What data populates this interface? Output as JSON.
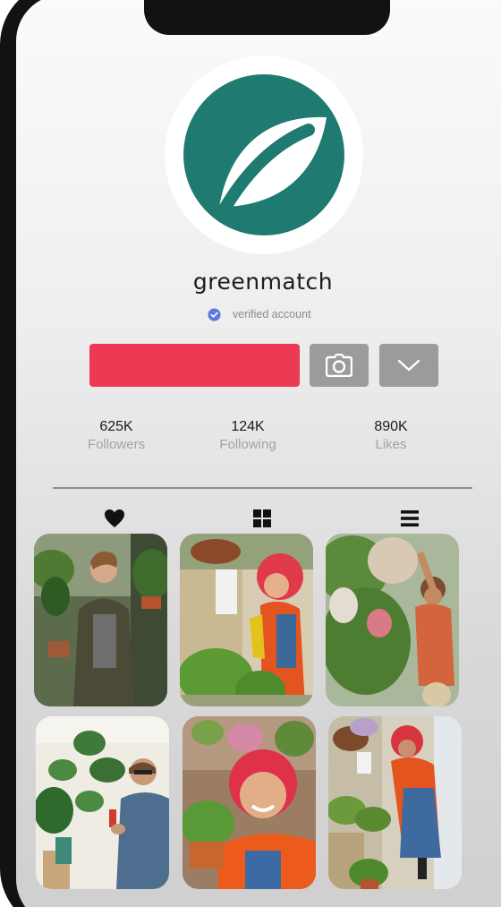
{
  "profile": {
    "username": "greenmatch",
    "verified_label": "verified account",
    "logo_icon": "leaf-logo-icon",
    "colors": {
      "logo": "#1f7a72",
      "follow_button": "#ec3a55",
      "secondary_button": "#9b9b9b",
      "verified_badge": "#5a78e0"
    }
  },
  "actions": {
    "follow_button_label": "",
    "camera_icon": "camera-icon",
    "more_icon": "chevron-down-icon"
  },
  "stats": [
    {
      "value": "625K",
      "label": "Followers"
    },
    {
      "value": "124K",
      "label": "Following"
    },
    {
      "value": "890K",
      "label": "Likes"
    }
  ],
  "tabs": [
    {
      "icon": "heart-icon"
    },
    {
      "icon": "grid-icon"
    },
    {
      "icon": "list-icon"
    }
  ],
  "posts": [
    {
      "subject": "woman holding potted plant in shop"
    },
    {
      "subject": "woman watering plants with yellow can"
    },
    {
      "subject": "woman reaching up to tall plants"
    },
    {
      "subject": "man spraying monstera plant"
    },
    {
      "subject": "smiling woman holding potted herb"
    },
    {
      "subject": "woman arranging plants at shop front"
    }
  ]
}
